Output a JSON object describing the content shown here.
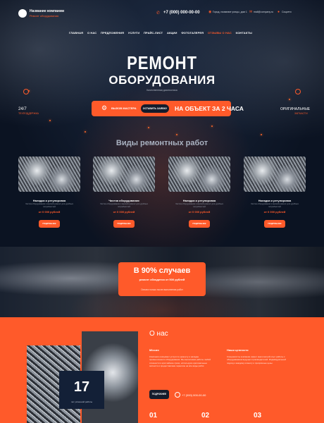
{
  "header": {
    "logo_line1": "Название компании",
    "logo_line2": "Ремонт оборудования",
    "phone": "+7 (000) 000-00-00",
    "address": "Город, название улицы, дом 1",
    "email": "mail@company.ru",
    "social": "Соцсети"
  },
  "nav": {
    "items": [
      "ГЛАВНАЯ",
      "О НАС",
      "ПРЕДЛОЖЕНИЯ",
      "УСЛУГИ",
      "ПРАЙС-ЛИСТ",
      "АКЦИИ",
      "ФОТОГАЛЕРЕЯ",
      "ОТЗЫВЫ О НАС",
      "КОНТАКТЫ"
    ],
    "active": "ОТЗЫВЫ О НАС"
  },
  "hero": {
    "title_line1": "РЕМОНТ",
    "title_line2": "ОБОРУДОВАНИЯ",
    "subtitle": "Качественная диагностика",
    "cta_label": "ВЫЗОВ МАСТЕРА",
    "cta_button": "ОСТАВИТЬ ЗАЯВКУ",
    "cta_big": "НА ОБЪЕКТ ЗА 2 ЧАСА",
    "left_title": "24/7",
    "left_sub": "ТЕХПОДДЕРЖКА",
    "right_title": "ОРИГИНАЛЬНЫЕ",
    "right_sub": "ЗАПЧАСТИ"
  },
  "services": {
    "title": "Виды ремонтных работ",
    "cards": [
      {
        "name": "Наладка и регулировка",
        "desc": "Чистка оборудования и мелкий ремонт для удобных потребностей",
        "price": "от 0 000 рублей",
        "button": "ПОДРОБНЕЕ"
      },
      {
        "name": "Чистка оборудования",
        "desc": "Чистка оборудования и мелкий ремонт для удобных потребностей",
        "price": "от 0 000 рублей",
        "button": "ПОДРОБНЕЕ"
      },
      {
        "name": "Наладка и регулировка",
        "desc": "Чистка оборудования и мелкий ремонт для удобных потребностей",
        "price": "от 0 000 рублей",
        "button": "ПОДРОБНЕЕ"
      },
      {
        "name": "Наладка и регулировка",
        "desc": "Чистка оборудования и мелкий ремонт для удобных потребностей",
        "price": "от 0 000 рублей",
        "button": "ПОДРОБНЕЕ"
      }
    ]
  },
  "promo": {
    "title": "В 90% случаев",
    "subtitle": "ремонт обходится от 500 рублей",
    "note": "Оплата только после выполнения работ"
  },
  "about": {
    "title": "О нас",
    "badge_number": "17",
    "badge_label": "лет успешной работы",
    "col1_heading": "Miссия",
    "col1_text": "Компания оказывает услуги по ремонту и наладке промышленного оборудования. Мы выполняем работы любой сложности в кратчайшие сроки, используем оригинальные запчасти и предоставляем гарантию на все виды работ.",
    "col2_heading": "Наши ценности",
    "col2_text": "Специалисты компании имеют многолетний опыт работы с оборудованием ведущих производителей. Индивидуальный подход к каждому клиенту и прозрачные цены.",
    "button": "ПОДРОБНЕЕ",
    "phone": "+7 (000) 000-00-00",
    "stats": [
      "01",
      "02",
      "03"
    ]
  },
  "colors": {
    "accent": "#ff5a2a",
    "dark": "#0b1322",
    "navy": "#132037"
  }
}
